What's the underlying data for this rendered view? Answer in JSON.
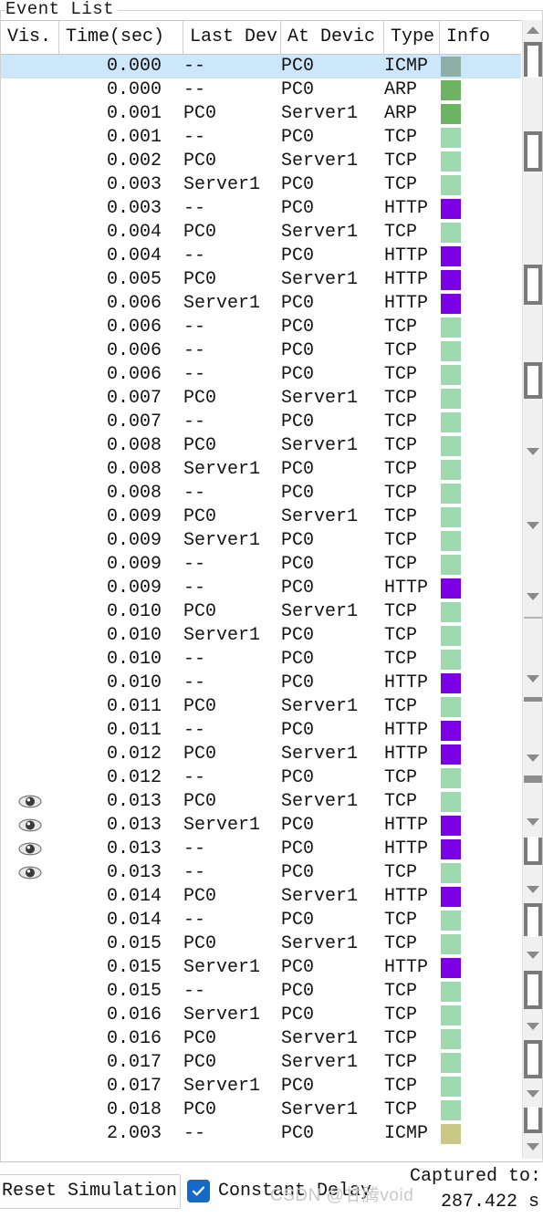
{
  "panel": {
    "title": "Event List"
  },
  "table": {
    "columns": [
      {
        "key": "vis",
        "label": "Vis."
      },
      {
        "key": "time",
        "label": "Time(sec)"
      },
      {
        "key": "last",
        "label": "Last Dev"
      },
      {
        "key": "at",
        "label": "At Devic"
      },
      {
        "key": "type",
        "label": "Type"
      },
      {
        "key": "info",
        "label": "Info"
      }
    ],
    "colors": {
      "ICMP_selected": "#8cb0a5",
      "ARP": "#6cb463",
      "TCP": "#9fd9b0",
      "HTTP": "#7c00e6",
      "ICMP_late": "#c9c985",
      "selected_row_bg": "#cce6fa"
    },
    "rows": [
      {
        "vis": "",
        "time": "0.000",
        "last": "--",
        "at": "PC0",
        "type": "ICMP",
        "color": "#8cb0a5",
        "selected": true
      },
      {
        "vis": "",
        "time": "0.000",
        "last": "--",
        "at": "PC0",
        "type": "ARP",
        "color": "#6cb463",
        "selected": false
      },
      {
        "vis": "",
        "time": "0.001",
        "last": "PC0",
        "at": "Server1",
        "type": "ARP",
        "color": "#6cb463",
        "selected": false
      },
      {
        "vis": "",
        "time": "0.001",
        "last": "--",
        "at": "PC0",
        "type": "TCP",
        "color": "#9fd9b0",
        "selected": false
      },
      {
        "vis": "",
        "time": "0.002",
        "last": "PC0",
        "at": "Server1",
        "type": "TCP",
        "color": "#9fd9b0",
        "selected": false
      },
      {
        "vis": "",
        "time": "0.003",
        "last": "Server1",
        "at": "PC0",
        "type": "TCP",
        "color": "#9fd9b0",
        "selected": false
      },
      {
        "vis": "",
        "time": "0.003",
        "last": "--",
        "at": "PC0",
        "type": "HTTP",
        "color": "#7c00e6",
        "selected": false
      },
      {
        "vis": "",
        "time": "0.004",
        "last": "PC0",
        "at": "Server1",
        "type": "TCP",
        "color": "#9fd9b0",
        "selected": false
      },
      {
        "vis": "",
        "time": "0.004",
        "last": "--",
        "at": "PC0",
        "type": "HTTP",
        "color": "#7c00e6",
        "selected": false
      },
      {
        "vis": "",
        "time": "0.005",
        "last": "PC0",
        "at": "Server1",
        "type": "HTTP",
        "color": "#7c00e6",
        "selected": false
      },
      {
        "vis": "",
        "time": "0.006",
        "last": "Server1",
        "at": "PC0",
        "type": "HTTP",
        "color": "#7c00e6",
        "selected": false
      },
      {
        "vis": "",
        "time": "0.006",
        "last": "--",
        "at": "PC0",
        "type": "TCP",
        "color": "#9fd9b0",
        "selected": false
      },
      {
        "vis": "",
        "time": "0.006",
        "last": "--",
        "at": "PC0",
        "type": "TCP",
        "color": "#9fd9b0",
        "selected": false
      },
      {
        "vis": "",
        "time": "0.006",
        "last": "--",
        "at": "PC0",
        "type": "TCP",
        "color": "#9fd9b0",
        "selected": false
      },
      {
        "vis": "",
        "time": "0.007",
        "last": "PC0",
        "at": "Server1",
        "type": "TCP",
        "color": "#9fd9b0",
        "selected": false
      },
      {
        "vis": "",
        "time": "0.007",
        "last": "--",
        "at": "PC0",
        "type": "TCP",
        "color": "#9fd9b0",
        "selected": false
      },
      {
        "vis": "",
        "time": "0.008",
        "last": "PC0",
        "at": "Server1",
        "type": "TCP",
        "color": "#9fd9b0",
        "selected": false
      },
      {
        "vis": "",
        "time": "0.008",
        "last": "Server1",
        "at": "PC0",
        "type": "TCP",
        "color": "#9fd9b0",
        "selected": false
      },
      {
        "vis": "",
        "time": "0.008",
        "last": "--",
        "at": "PC0",
        "type": "TCP",
        "color": "#9fd9b0",
        "selected": false
      },
      {
        "vis": "",
        "time": "0.009",
        "last": "PC0",
        "at": "Server1",
        "type": "TCP",
        "color": "#9fd9b0",
        "selected": false
      },
      {
        "vis": "",
        "time": "0.009",
        "last": "Server1",
        "at": "PC0",
        "type": "TCP",
        "color": "#9fd9b0",
        "selected": false
      },
      {
        "vis": "",
        "time": "0.009",
        "last": "--",
        "at": "PC0",
        "type": "TCP",
        "color": "#9fd9b0",
        "selected": false
      },
      {
        "vis": "",
        "time": "0.009",
        "last": "--",
        "at": "PC0",
        "type": "HTTP",
        "color": "#7c00e6",
        "selected": false
      },
      {
        "vis": "",
        "time": "0.010",
        "last": "PC0",
        "at": "Server1",
        "type": "TCP",
        "color": "#9fd9b0",
        "selected": false
      },
      {
        "vis": "",
        "time": "0.010",
        "last": "Server1",
        "at": "PC0",
        "type": "TCP",
        "color": "#9fd9b0",
        "selected": false
      },
      {
        "vis": "",
        "time": "0.010",
        "last": "--",
        "at": "PC0",
        "type": "TCP",
        "color": "#9fd9b0",
        "selected": false
      },
      {
        "vis": "",
        "time": "0.010",
        "last": "--",
        "at": "PC0",
        "type": "HTTP",
        "color": "#7c00e6",
        "selected": false
      },
      {
        "vis": "",
        "time": "0.011",
        "last": "PC0",
        "at": "Server1",
        "type": "TCP",
        "color": "#9fd9b0",
        "selected": false
      },
      {
        "vis": "",
        "time": "0.011",
        "last": "--",
        "at": "PC0",
        "type": "HTTP",
        "color": "#7c00e6",
        "selected": false
      },
      {
        "vis": "",
        "time": "0.012",
        "last": "PC0",
        "at": "Server1",
        "type": "HTTP",
        "color": "#7c00e6",
        "selected": false
      },
      {
        "vis": "",
        "time": "0.012",
        "last": "--",
        "at": "PC0",
        "type": "TCP",
        "color": "#9fd9b0",
        "selected": false
      },
      {
        "vis": "eye-icon",
        "time": "0.013",
        "last": "PC0",
        "at": "Server1",
        "type": "TCP",
        "color": "#9fd9b0",
        "selected": false
      },
      {
        "vis": "eye-icon",
        "time": "0.013",
        "last": "Server1",
        "at": "PC0",
        "type": "HTTP",
        "color": "#7c00e6",
        "selected": false
      },
      {
        "vis": "eye-icon",
        "time": "0.013",
        "last": "--",
        "at": "PC0",
        "type": "HTTP",
        "color": "#7c00e6",
        "selected": false
      },
      {
        "vis": "eye-icon",
        "time": "0.013",
        "last": "--",
        "at": "PC0",
        "type": "TCP",
        "color": "#9fd9b0",
        "selected": false
      },
      {
        "vis": "",
        "time": "0.014",
        "last": "PC0",
        "at": "Server1",
        "type": "HTTP",
        "color": "#7c00e6",
        "selected": false
      },
      {
        "vis": "",
        "time": "0.014",
        "last": "--",
        "at": "PC0",
        "type": "TCP",
        "color": "#9fd9b0",
        "selected": false
      },
      {
        "vis": "",
        "time": "0.015",
        "last": "PC0",
        "at": "Server1",
        "type": "TCP",
        "color": "#9fd9b0",
        "selected": false
      },
      {
        "vis": "",
        "time": "0.015",
        "last": "Server1",
        "at": "PC0",
        "type": "HTTP",
        "color": "#7c00e6",
        "selected": false
      },
      {
        "vis": "",
        "time": "0.015",
        "last": "--",
        "at": "PC0",
        "type": "TCP",
        "color": "#9fd9b0",
        "selected": false
      },
      {
        "vis": "",
        "time": "0.016",
        "last": "Server1",
        "at": "PC0",
        "type": "TCP",
        "color": "#9fd9b0",
        "selected": false
      },
      {
        "vis": "",
        "time": "0.016",
        "last": "PC0",
        "at": "Server1",
        "type": "TCP",
        "color": "#9fd9b0",
        "selected": false
      },
      {
        "vis": "",
        "time": "0.017",
        "last": "PC0",
        "at": "Server1",
        "type": "TCP",
        "color": "#9fd9b0",
        "selected": false
      },
      {
        "vis": "",
        "time": "0.017",
        "last": "Server1",
        "at": "PC0",
        "type": "TCP",
        "color": "#9fd9b0",
        "selected": false
      },
      {
        "vis": "",
        "time": "0.018",
        "last": "PC0",
        "at": "Server1",
        "type": "TCP",
        "color": "#9fd9b0",
        "selected": false
      },
      {
        "vis": "",
        "time": "2.003",
        "last": "--",
        "at": "PC0",
        "type": "ICMP",
        "color": "#c9c985",
        "selected": false
      }
    ]
  },
  "toolbar": {
    "reset_label": "Reset Simulation",
    "constant_delay_label": "Constant Delay",
    "constant_delay_checked": true,
    "captured_label": "Captured to:",
    "captured_value": "287.422 s"
  },
  "watermark": {
    "text": "CSDN @甘腾void"
  }
}
